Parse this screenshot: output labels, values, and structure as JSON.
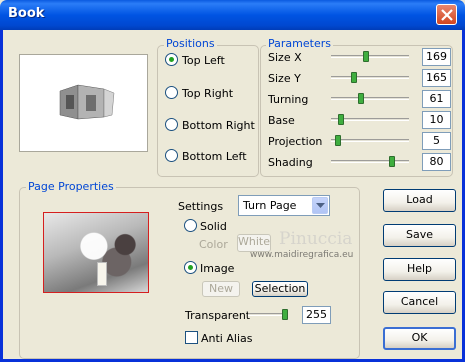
{
  "window": {
    "title": "Book"
  },
  "icons": {
    "close": "close-icon",
    "dropdown": "chevron-down-icon"
  },
  "positions": {
    "label": "Positions",
    "options": [
      "Top Left",
      "Top Right",
      "Bottom Right",
      "Bottom Left"
    ],
    "selected": "Top Left"
  },
  "parameters": {
    "label": "Parameters",
    "rows": [
      {
        "label": "Size X",
        "value": "169",
        "level": 0.45
      },
      {
        "label": "Size Y",
        "value": "165",
        "level": 0.28
      },
      {
        "label": "Turning",
        "value": "61",
        "level": 0.38
      },
      {
        "label": "Base",
        "value": "10",
        "level": 0.1
      },
      {
        "label": "Projection",
        "value": "5",
        "level": 0.05
      },
      {
        "label": "Shading",
        "value": "80",
        "level": 0.8
      }
    ]
  },
  "page_properties": {
    "label": "Page Properties",
    "settings_label": "Settings",
    "settings_value": "Turn Page",
    "solid_label": "Solid",
    "color_label": "Color",
    "color_value": "White",
    "image_label": "Image",
    "image_selected": true,
    "new_label": "New",
    "selection_label": "Selection",
    "transparent_label": "Transparent",
    "transparent_value": "255",
    "transparent_level": 1.0,
    "anti_alias_label": "Anti Alias",
    "anti_alias_checked": false
  },
  "watermark": {
    "name": "Pinuccia",
    "url": "www.maidiregrafica.eu"
  },
  "buttons": {
    "load": "Load",
    "save": "Save",
    "help": "Help",
    "cancel": "Cancel",
    "ok": "OK"
  }
}
